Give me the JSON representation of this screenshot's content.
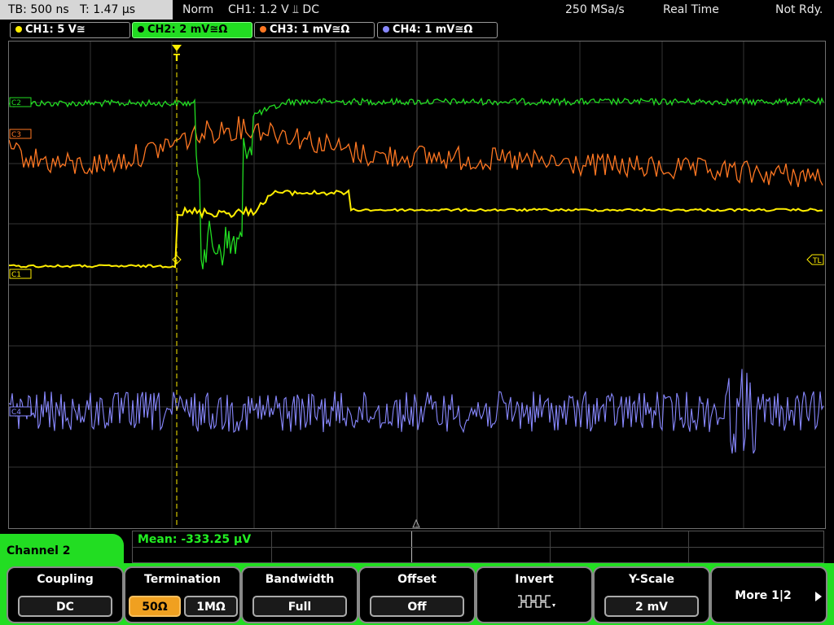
{
  "status": {
    "timebase": "TB: 500 ns",
    "trigger_time": "T: 1.47 µs",
    "mode": "Norm",
    "trigger": "CH1: 1.2 V ⫫ DC",
    "sample_rate": "250 MSa/s",
    "acq_mode": "Real Time",
    "ready": "Not Rdy."
  },
  "channels": [
    {
      "label": "CH1: 5 V≅",
      "color": "#ffee00"
    },
    {
      "label": "CH2: 2 mV≅Ω",
      "color": "#22dd22"
    },
    {
      "label": "CH3: 1 mV≅Ω",
      "color": "#ff7722"
    },
    {
      "label": "CH4: 1 mV≅Ω",
      "color": "#8888ff"
    }
  ],
  "markers": {
    "c1": "C1",
    "c2": "C2",
    "c3": "C3",
    "c4": "C4",
    "trigger_level": "TL",
    "trigger_pos": "T"
  },
  "measurement": {
    "mean": "Mean: -333.25 µV"
  },
  "menu": {
    "title": "Channel 2",
    "coupling": {
      "title": "Coupling",
      "value": "DC"
    },
    "termination": {
      "title": "Termination",
      "opt1": "50Ω",
      "opt2": "1MΩ"
    },
    "bandwidth": {
      "title": "Bandwidth",
      "value": "Full"
    },
    "offset": {
      "title": "Offset",
      "value": "Off"
    },
    "invert": {
      "title": "Invert",
      "icon": "inverted-pulse-icon"
    },
    "yscale": {
      "title": "Y-Scale",
      "value": "2 mV"
    },
    "more": {
      "label": "More 1|2",
      "icon": "arrow-right-icon"
    }
  }
}
